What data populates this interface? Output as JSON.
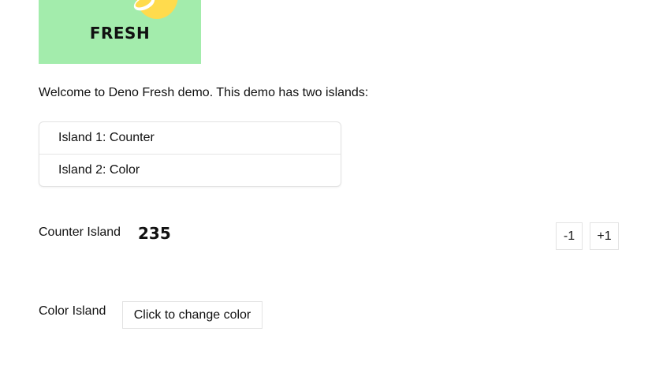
{
  "logo": {
    "text": "FRESH",
    "background_color": "#a3ecac",
    "accent_color": "#ffdb4d"
  },
  "intro": {
    "text": "Welcome to Deno Fresh demo. This demo has two islands:"
  },
  "islands": [
    {
      "label": "Island 1: Counter"
    },
    {
      "label": "Island 2: Color"
    }
  ],
  "counter": {
    "label": "Counter Island",
    "value": "235",
    "decrement_label": "-1",
    "increment_label": "+1"
  },
  "color": {
    "label": "Color Island",
    "button_label": "Click to change color"
  }
}
